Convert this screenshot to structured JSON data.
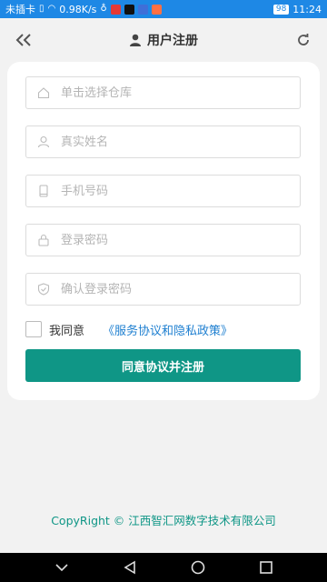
{
  "status_bar": {
    "carrier": "未插卡",
    "speed": "0.98K/s",
    "battery": "98",
    "time": "11:24"
  },
  "header": {
    "title": "用户注册"
  },
  "form": {
    "warehouse_placeholder": "单击选择仓库",
    "name_placeholder": "真实姓名",
    "phone_placeholder": "手机号码",
    "password_placeholder": "登录密码",
    "confirm_placeholder": "确认登录密码",
    "agree_label": "我同意",
    "agreement_link": "《服务协议和隐私政策》",
    "submit_label": "同意协议并注册"
  },
  "footer": {
    "copyright": "CopyRight © 江西智汇网数字技术有限公司"
  },
  "colors": {
    "status_bar": "#1e88e5",
    "primary": "#0f9686",
    "link": "#1e7fd0",
    "background": "#f2f2f2"
  },
  "icons": {
    "back": "double-chevron-left-icon",
    "user": "user-icon",
    "refresh": "refresh-icon",
    "warehouse": "home-icon",
    "name": "person-icon",
    "phone": "phone-icon",
    "password": "lock-icon",
    "confirm": "shield-icon"
  }
}
